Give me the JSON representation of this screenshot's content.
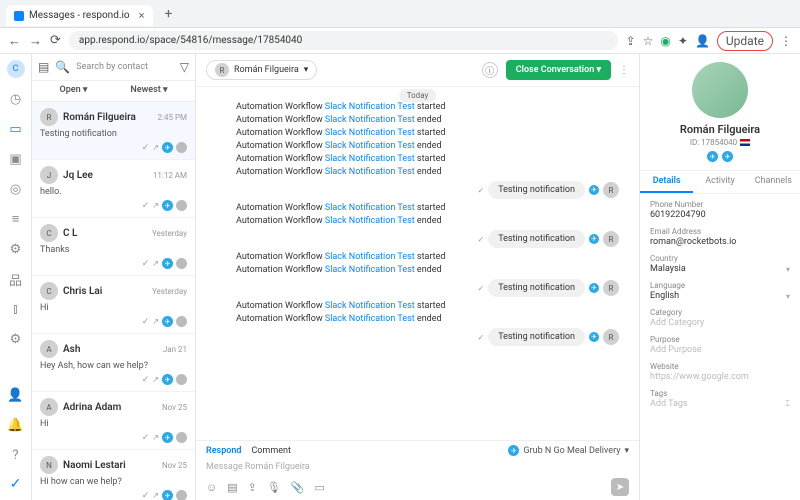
{
  "browser": {
    "tab_title": "Messages - respond.io",
    "url": "app.respond.io/space/54816/message/17854040",
    "update": "Update"
  },
  "search_placeholder": "Search by contact",
  "filters": {
    "open": "Open",
    "newest": "Newest"
  },
  "conversations": [
    {
      "name": "Román Filgueira",
      "time": "2:45 PM",
      "msg": "Testing notification",
      "sel": true
    },
    {
      "name": "Jq Lee",
      "time": "11:12 AM",
      "msg": "hello."
    },
    {
      "name": "C L",
      "time": "Yesterday",
      "msg": "Thanks"
    },
    {
      "name": "Chris Lai",
      "time": "Yesterday",
      "msg": "Hi"
    },
    {
      "name": "Ash",
      "time": "Jan 21",
      "msg": "Hey Ash, how can we help?"
    },
    {
      "name": "Adrina Adam",
      "time": "Nov 25",
      "msg": "Hi"
    },
    {
      "name": "Naomi Lestari",
      "time": "Nov 25",
      "msg": "Hi how can we help?"
    }
  ],
  "header": {
    "assignee": "Román Filgueira",
    "close": "Close Conversation"
  },
  "today": "Today",
  "wf": {
    "prefix": "Automation Workflow ",
    "link": "Slack Notification Test",
    "started": " started",
    "ended": " ended"
  },
  "out_msg": "Testing notification",
  "composer": {
    "respond": "Respond",
    "comment": "Comment",
    "channel": "Grub N Go Meal Delivery",
    "placeholder": "Message Román Filgueira"
  },
  "profile": {
    "name": "Román Filgueira",
    "id": "ID: 17854040"
  },
  "dtabs": {
    "details": "Details",
    "activity": "Activity",
    "channels": "Channels"
  },
  "fields": {
    "phone_l": "Phone Number",
    "phone_v": "60192204790",
    "email_l": "Email Address",
    "email_v": "roman@rocketbots.io",
    "country_l": "Country",
    "country_v": "Malaysia",
    "lang_l": "Language",
    "lang_v": "English",
    "cat_l": "Category",
    "cat_v": "Add Category",
    "purpose_l": "Purpose",
    "purpose_v": "Add Purpose",
    "web_l": "Website",
    "web_v": "https://www.google.com",
    "tags_l": "Tags",
    "tags_v": "Add Tags"
  }
}
